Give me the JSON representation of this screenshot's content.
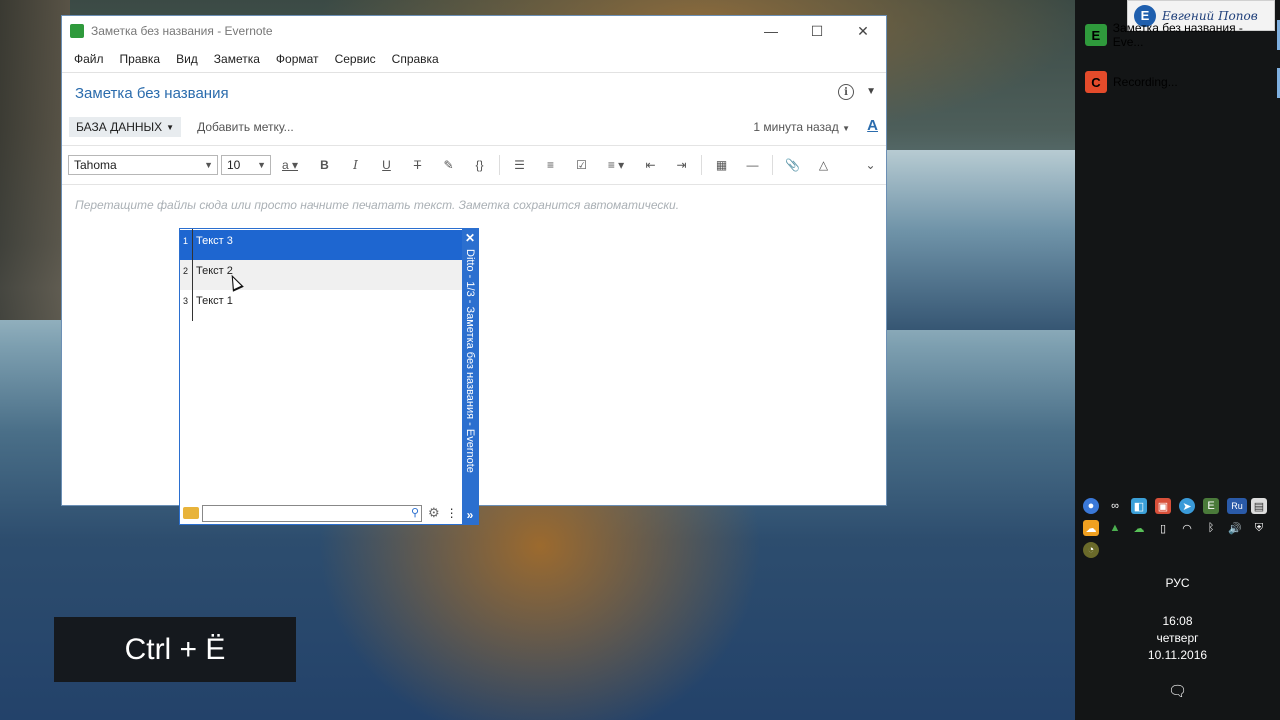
{
  "desktop": {
    "hotkey_overlay": "Ctrl + Ё"
  },
  "evernote": {
    "window_title": "Заметка без названия - Evernote",
    "window_controls": {
      "minimize": "—",
      "maximize": "☐",
      "close": "✕"
    },
    "menu": [
      "Файл",
      "Правка",
      "Вид",
      "Заметка",
      "Формат",
      "Сервис",
      "Справка"
    ],
    "note_title": "Заметка без названия",
    "notebook": "БАЗА ДАННЫХ",
    "add_tag": "Добавить метку...",
    "updated": "1 минута назад",
    "font_family": "Tahoma",
    "font_size": "10",
    "placeholder": "Перетащите файлы сюда или просто начните печатать текст. Заметка сохранится автоматически.",
    "toolbar_icons": [
      "font-color-icon",
      "bold-icon",
      "italic-icon",
      "underline-icon",
      "strikethrough-icon",
      "highlight-icon",
      "code-icon",
      "bullet-list-icon",
      "numbered-list-icon",
      "checkbox-icon",
      "align-icon",
      "outdent-icon",
      "indent-icon",
      "table-icon",
      "horizontal-rule-icon",
      "attach-icon",
      "drive-icon",
      "more-icon"
    ]
  },
  "ditto": {
    "caption": "Ditto - 1/3 - Заметка без названия - Evernote",
    "items": [
      {
        "num": "1",
        "text": "Текст 3"
      },
      {
        "num": "2",
        "text": "Текст 2"
      },
      {
        "num": "3",
        "text": "Текст 1"
      }
    ],
    "search_value": ""
  },
  "taskbar": {
    "logo_text": "Евгений Попов",
    "items": [
      {
        "label": "Заметка без названия - Eve...",
        "icon": "evernote-icon",
        "color": "#2f9a3c"
      },
      {
        "label": "Recording...",
        "icon": "camtasia-icon",
        "color": "#e44b2b"
      }
    ],
    "language": "РУС",
    "time": "16:08",
    "weekday": "четверг",
    "date": "10.11.2016"
  }
}
